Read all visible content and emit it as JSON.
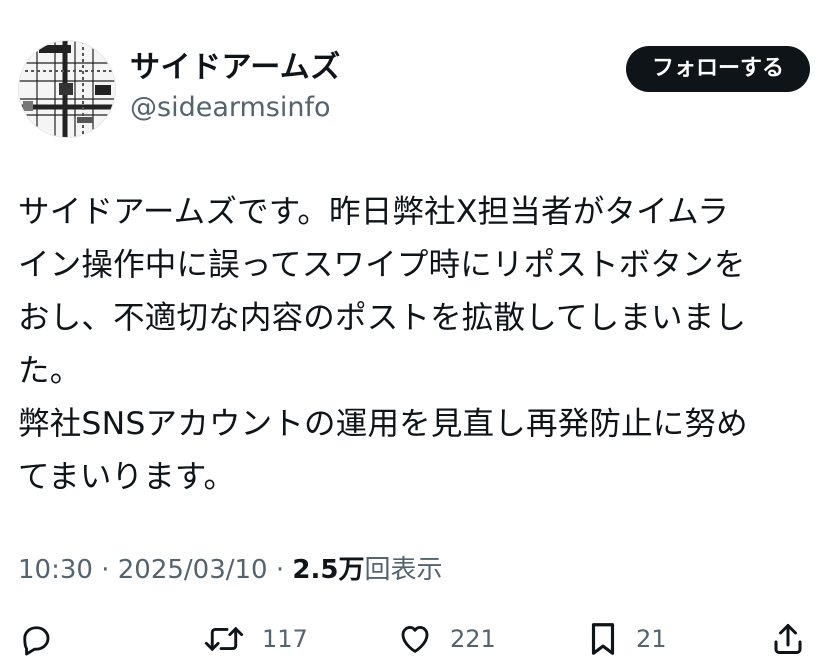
{
  "account": {
    "display_name": "サイドアームズ",
    "handle": "@sidearmsinfo",
    "follow_label": "フォローする"
  },
  "post": {
    "lines": [
      "サイドアームズです。昨日弊社X担当者がタイムラ",
      "イン操作中に誤ってスワイプ時にリポストボタンを",
      "おし、不適切な内容のポストを拡散してしまいまし",
      "た。",
      "弊社SNSアカウントの運用を見直し再発防止に努め",
      "てまいります。"
    ]
  },
  "meta": {
    "time": "10:30",
    "separator": " · ",
    "date": "2025/03/10",
    "views_count": "2.5万",
    "views_label": "回表示"
  },
  "actions": {
    "reply_count": "",
    "repost_count": "117",
    "like_count": "221",
    "bookmark_count": "21"
  }
}
